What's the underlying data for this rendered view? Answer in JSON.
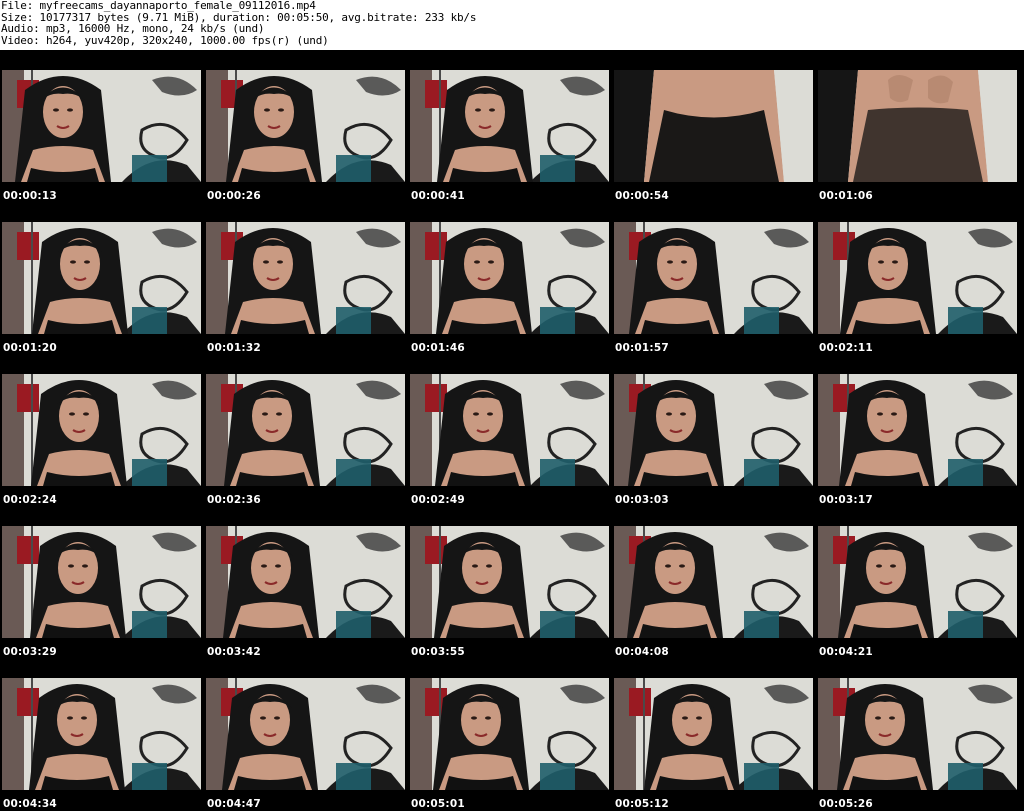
{
  "header": {
    "file": "File: myfreecams_dayannaporto_female_09112016.mp4",
    "size": "Size: 10177317 bytes (9.71 MiB), duration: 00:05:50, avg.bitrate: 233 kb/s",
    "audio": "Audio: mp3, 16000 Hz, mono, 24 kb/s (und)",
    "video": "Video: h264, yuv420p, 320x240, 1000.00 fps(r) (und)"
  },
  "colors": {
    "sheet_background": "#000000",
    "wall": "#dcdcd6",
    "hair": "#151515",
    "skin": "#c99a82",
    "red_panel": "#9a1a22",
    "cushion": "#1f5e6a"
  },
  "thumbnails": [
    {
      "time": "00:00:13",
      "scene": "face"
    },
    {
      "time": "00:00:26",
      "scene": "face"
    },
    {
      "time": "00:00:41",
      "scene": "face"
    },
    {
      "time": "00:00:54",
      "scene": "torso"
    },
    {
      "time": "00:01:06",
      "scene": "torso-sheer"
    },
    {
      "time": "00:01:20",
      "scene": "face"
    },
    {
      "time": "00:01:32",
      "scene": "face"
    },
    {
      "time": "00:01:46",
      "scene": "face"
    },
    {
      "time": "00:01:57",
      "scene": "face"
    },
    {
      "time": "00:02:11",
      "scene": "face"
    },
    {
      "time": "00:02:24",
      "scene": "face"
    },
    {
      "time": "00:02:36",
      "scene": "face"
    },
    {
      "time": "00:02:49",
      "scene": "face"
    },
    {
      "time": "00:03:03",
      "scene": "face"
    },
    {
      "time": "00:03:17",
      "scene": "face"
    },
    {
      "time": "00:03:29",
      "scene": "face"
    },
    {
      "time": "00:03:42",
      "scene": "face"
    },
    {
      "time": "00:03:55",
      "scene": "face"
    },
    {
      "time": "00:04:08",
      "scene": "face"
    },
    {
      "time": "00:04:21",
      "scene": "face"
    },
    {
      "time": "00:04:34",
      "scene": "face"
    },
    {
      "time": "00:04:47",
      "scene": "face"
    },
    {
      "time": "00:05:01",
      "scene": "face"
    },
    {
      "time": "00:05:12",
      "scene": "face"
    },
    {
      "time": "00:05:26",
      "scene": "face"
    }
  ]
}
